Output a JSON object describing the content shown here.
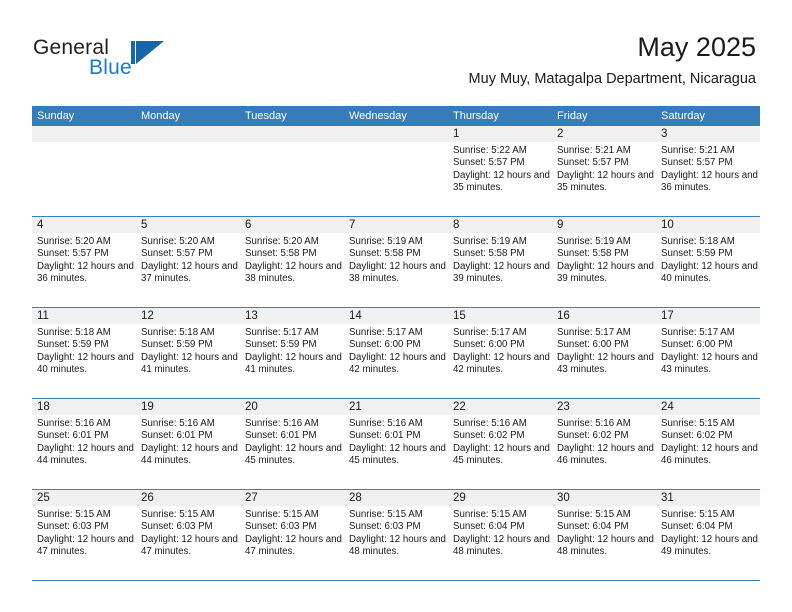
{
  "brand": {
    "name_top": "General",
    "name_bottom": "Blue",
    "mark": "flag-triangle-icon",
    "accent_color": "#1a7bc4"
  },
  "header": {
    "month_title": "May 2025",
    "location": "Muy Muy, Matagalpa Department, Nicaragua"
  },
  "theme": {
    "header_blue": "#357cb9",
    "row_divider_blue": "#3b7fbb",
    "daynum_band_gray": "#f0f0f0",
    "text_color": "#1a1a1a"
  },
  "weekdays": [
    "Sunday",
    "Monday",
    "Tuesday",
    "Wednesday",
    "Thursday",
    "Friday",
    "Saturday"
  ],
  "weeks": [
    [
      {
        "day": "",
        "sunrise": "",
        "sunset": "",
        "daylight": "",
        "empty": true
      },
      {
        "day": "",
        "sunrise": "",
        "sunset": "",
        "daylight": "",
        "empty": true
      },
      {
        "day": "",
        "sunrise": "",
        "sunset": "",
        "daylight": "",
        "empty": true
      },
      {
        "day": "",
        "sunrise": "",
        "sunset": "",
        "daylight": "",
        "empty": true
      },
      {
        "day": "1",
        "sunrise": "Sunrise: 5:22 AM",
        "sunset": "Sunset: 5:57 PM",
        "daylight": "Daylight: 12 hours and 35 minutes."
      },
      {
        "day": "2",
        "sunrise": "Sunrise: 5:21 AM",
        "sunset": "Sunset: 5:57 PM",
        "daylight": "Daylight: 12 hours and 35 minutes."
      },
      {
        "day": "3",
        "sunrise": "Sunrise: 5:21 AM",
        "sunset": "Sunset: 5:57 PM",
        "daylight": "Daylight: 12 hours and 36 minutes."
      }
    ],
    [
      {
        "day": "4",
        "sunrise": "Sunrise: 5:20 AM",
        "sunset": "Sunset: 5:57 PM",
        "daylight": "Daylight: 12 hours and 36 minutes."
      },
      {
        "day": "5",
        "sunrise": "Sunrise: 5:20 AM",
        "sunset": "Sunset: 5:57 PM",
        "daylight": "Daylight: 12 hours and 37 minutes."
      },
      {
        "day": "6",
        "sunrise": "Sunrise: 5:20 AM",
        "sunset": "Sunset: 5:58 PM",
        "daylight": "Daylight: 12 hours and 38 minutes."
      },
      {
        "day": "7",
        "sunrise": "Sunrise: 5:19 AM",
        "sunset": "Sunset: 5:58 PM",
        "daylight": "Daylight: 12 hours and 38 minutes."
      },
      {
        "day": "8",
        "sunrise": "Sunrise: 5:19 AM",
        "sunset": "Sunset: 5:58 PM",
        "daylight": "Daylight: 12 hours and 39 minutes."
      },
      {
        "day": "9",
        "sunrise": "Sunrise: 5:19 AM",
        "sunset": "Sunset: 5:58 PM",
        "daylight": "Daylight: 12 hours and 39 minutes."
      },
      {
        "day": "10",
        "sunrise": "Sunrise: 5:18 AM",
        "sunset": "Sunset: 5:59 PM",
        "daylight": "Daylight: 12 hours and 40 minutes."
      }
    ],
    [
      {
        "day": "11",
        "sunrise": "Sunrise: 5:18 AM",
        "sunset": "Sunset: 5:59 PM",
        "daylight": "Daylight: 12 hours and 40 minutes."
      },
      {
        "day": "12",
        "sunrise": "Sunrise: 5:18 AM",
        "sunset": "Sunset: 5:59 PM",
        "daylight": "Daylight: 12 hours and 41 minutes."
      },
      {
        "day": "13",
        "sunrise": "Sunrise: 5:17 AM",
        "sunset": "Sunset: 5:59 PM",
        "daylight": "Daylight: 12 hours and 41 minutes."
      },
      {
        "day": "14",
        "sunrise": "Sunrise: 5:17 AM",
        "sunset": "Sunset: 6:00 PM",
        "daylight": "Daylight: 12 hours and 42 minutes."
      },
      {
        "day": "15",
        "sunrise": "Sunrise: 5:17 AM",
        "sunset": "Sunset: 6:00 PM",
        "daylight": "Daylight: 12 hours and 42 minutes."
      },
      {
        "day": "16",
        "sunrise": "Sunrise: 5:17 AM",
        "sunset": "Sunset: 6:00 PM",
        "daylight": "Daylight: 12 hours and 43 minutes."
      },
      {
        "day": "17",
        "sunrise": "Sunrise: 5:17 AM",
        "sunset": "Sunset: 6:00 PM",
        "daylight": "Daylight: 12 hours and 43 minutes."
      }
    ],
    [
      {
        "day": "18",
        "sunrise": "Sunrise: 5:16 AM",
        "sunset": "Sunset: 6:01 PM",
        "daylight": "Daylight: 12 hours and 44 minutes."
      },
      {
        "day": "19",
        "sunrise": "Sunrise: 5:16 AM",
        "sunset": "Sunset: 6:01 PM",
        "daylight": "Daylight: 12 hours and 44 minutes."
      },
      {
        "day": "20",
        "sunrise": "Sunrise: 5:16 AM",
        "sunset": "Sunset: 6:01 PM",
        "daylight": "Daylight: 12 hours and 45 minutes."
      },
      {
        "day": "21",
        "sunrise": "Sunrise: 5:16 AM",
        "sunset": "Sunset: 6:01 PM",
        "daylight": "Daylight: 12 hours and 45 minutes."
      },
      {
        "day": "22",
        "sunrise": "Sunrise: 5:16 AM",
        "sunset": "Sunset: 6:02 PM",
        "daylight": "Daylight: 12 hours and 45 minutes."
      },
      {
        "day": "23",
        "sunrise": "Sunrise: 5:16 AM",
        "sunset": "Sunset: 6:02 PM",
        "daylight": "Daylight: 12 hours and 46 minutes."
      },
      {
        "day": "24",
        "sunrise": "Sunrise: 5:15 AM",
        "sunset": "Sunset: 6:02 PM",
        "daylight": "Daylight: 12 hours and 46 minutes."
      }
    ],
    [
      {
        "day": "25",
        "sunrise": "Sunrise: 5:15 AM",
        "sunset": "Sunset: 6:03 PM",
        "daylight": "Daylight: 12 hours and 47 minutes."
      },
      {
        "day": "26",
        "sunrise": "Sunrise: 5:15 AM",
        "sunset": "Sunset: 6:03 PM",
        "daylight": "Daylight: 12 hours and 47 minutes."
      },
      {
        "day": "27",
        "sunrise": "Sunrise: 5:15 AM",
        "sunset": "Sunset: 6:03 PM",
        "daylight": "Daylight: 12 hours and 47 minutes."
      },
      {
        "day": "28",
        "sunrise": "Sunrise: 5:15 AM",
        "sunset": "Sunset: 6:03 PM",
        "daylight": "Daylight: 12 hours and 48 minutes."
      },
      {
        "day": "29",
        "sunrise": "Sunrise: 5:15 AM",
        "sunset": "Sunset: 6:04 PM",
        "daylight": "Daylight: 12 hours and 48 minutes."
      },
      {
        "day": "30",
        "sunrise": "Sunrise: 5:15 AM",
        "sunset": "Sunset: 6:04 PM",
        "daylight": "Daylight: 12 hours and 48 minutes."
      },
      {
        "day": "31",
        "sunrise": "Sunrise: 5:15 AM",
        "sunset": "Sunset: 6:04 PM",
        "daylight": "Daylight: 12 hours and 49 minutes."
      }
    ]
  ]
}
